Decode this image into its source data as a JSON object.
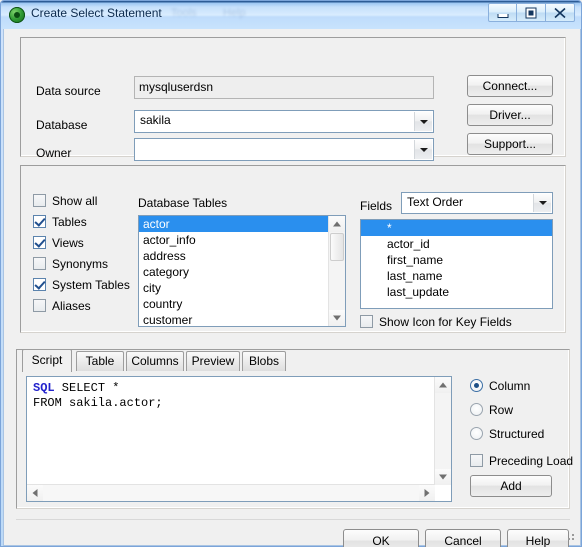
{
  "window": {
    "title": "Create Select Statement",
    "icon": "qlik-green-circle-icon",
    "ghost_text_1": "Tools",
    "ghost_text_2": "Help",
    "minimize_label": "Minimize",
    "restore_label": "Restore",
    "close_label": "Close",
    "accent_selection_color": "#2a8fee",
    "titlebar_color": "#c8e3fd"
  },
  "connection": {
    "datasource_label": "Data source",
    "datasource_value": "mysqluserdsn",
    "database_label": "Database",
    "database_value": "sakila",
    "owner_label": "Owner",
    "owner_value": "",
    "connect_button": "Connect...",
    "driver_button": "Driver...",
    "support_button": "Support..."
  },
  "filters": {
    "items": [
      {
        "label": "Show all",
        "checked": false
      },
      {
        "label": "Tables",
        "checked": true
      },
      {
        "label": "Views",
        "checked": true
      },
      {
        "label": "Synonyms",
        "checked": false
      },
      {
        "label": "System Tables",
        "checked": true
      },
      {
        "label": "Aliases",
        "checked": false
      }
    ]
  },
  "tables": {
    "header": "Database Tables",
    "items": [
      {
        "name": "actor",
        "selected": true
      },
      {
        "name": "actor_info",
        "selected": false
      },
      {
        "name": "address",
        "selected": false
      },
      {
        "name": "category",
        "selected": false
      },
      {
        "name": "city",
        "selected": false
      },
      {
        "name": "country",
        "selected": false
      },
      {
        "name": "customer",
        "selected": false
      }
    ]
  },
  "fields": {
    "label": "Fields",
    "order_value": "Text Order",
    "items": [
      {
        "name": "*",
        "selected": true
      },
      {
        "name": "actor_id",
        "selected": false
      },
      {
        "name": "first_name",
        "selected": false
      },
      {
        "name": "last_name",
        "selected": false
      },
      {
        "name": "last_update",
        "selected": false
      }
    ],
    "show_icon_label": "Show Icon for Key Fields",
    "show_icon_checked": false
  },
  "tabs": [
    {
      "label": "Script",
      "active": true
    },
    {
      "label": "Table",
      "active": false
    },
    {
      "label": "Columns",
      "active": false
    },
    {
      "label": "Preview",
      "active": false
    },
    {
      "label": "Blobs",
      "active": false
    }
  ],
  "script": {
    "keyword": "SQL",
    "line1_rest": " SELECT *",
    "line2": "FROM sakila.actor;"
  },
  "options": {
    "radios": [
      {
        "label": "Column",
        "selected": true
      },
      {
        "label": "Row",
        "selected": false
      },
      {
        "label": "Structured",
        "selected": false
      }
    ],
    "preceding_load_label": "Preceding Load",
    "preceding_load_checked": false,
    "add_button": "Add"
  },
  "footer": {
    "ok_button": "OK",
    "cancel_button": "Cancel",
    "help_button": "Help"
  }
}
